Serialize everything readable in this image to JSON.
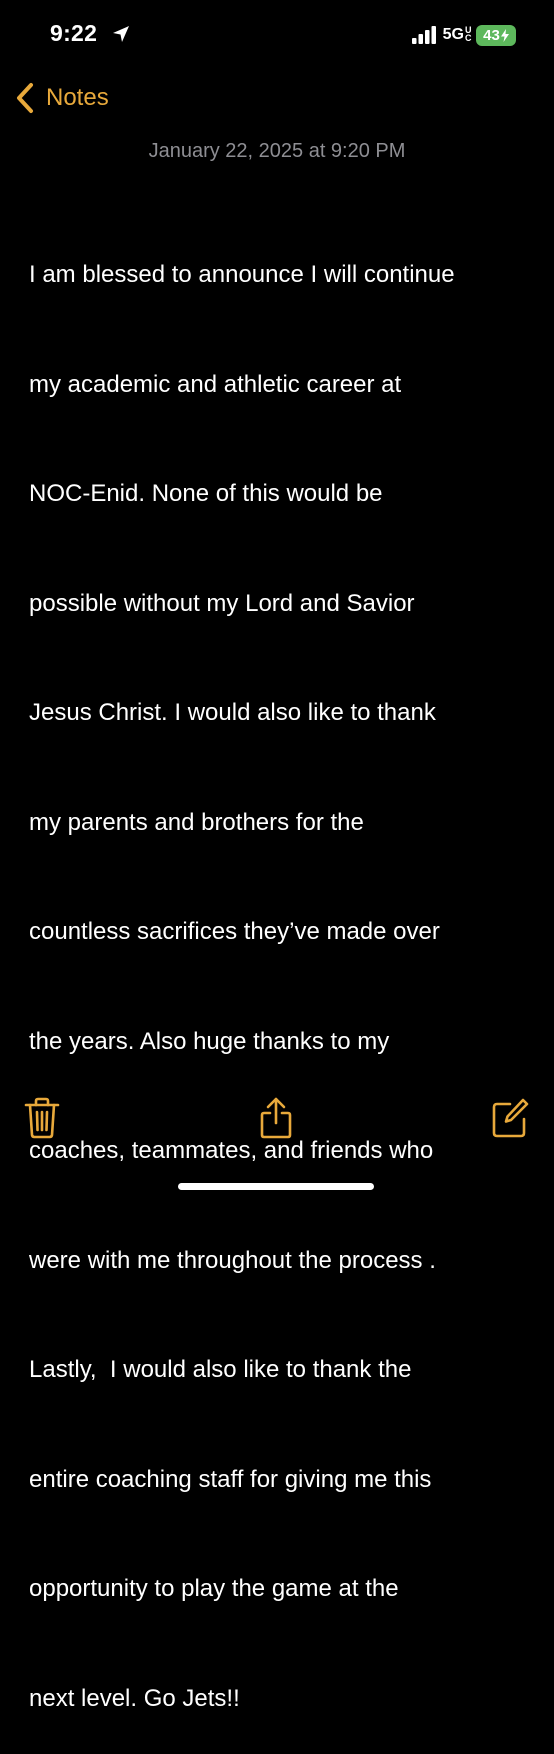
{
  "status_bar": {
    "time": "9:22",
    "network": "5G",
    "network_suffix": "UC",
    "battery": "43"
  },
  "nav": {
    "back_label": "Notes"
  },
  "note": {
    "date": "January 22, 2025 at 9:20 PM",
    "lines": [
      "I am blessed to announce I will continue",
      "my academic and athletic career at",
      "NOC-Enid. None of this would be",
      "possible without my Lord and Savior",
      "Jesus Christ. I would also like to thank",
      "my parents and brothers for the",
      "countless sacrifices they’ve made over",
      "the years. Also huge thanks to my",
      "coaches, teammates, and friends who",
      "were with me throughout the process .",
      "Lastly,  I would also like to thank the",
      "entire coaching staff for giving me this",
      "opportunity to play the game at the",
      "next level. Go Jets!!"
    ]
  },
  "toolbar": {
    "icons": [
      "trash-icon",
      "share-icon",
      "compose-icon"
    ]
  },
  "colors": {
    "accent": "#e8a93b",
    "background": "#000000",
    "text": "#ffffff",
    "secondary_text": "#8e8e93",
    "battery": "#5db85c"
  }
}
